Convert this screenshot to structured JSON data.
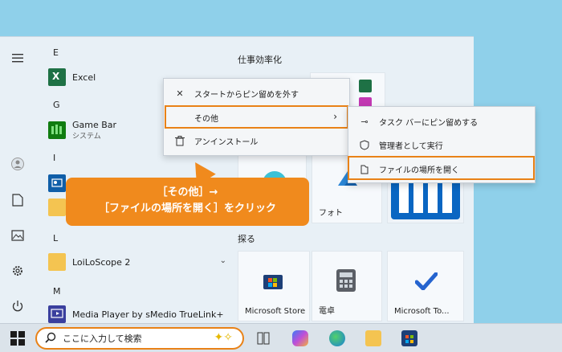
{
  "sections": {
    "letters": [
      "E",
      "G",
      "I",
      "L",
      "M"
    ],
    "pinned": "仕事効率化",
    "explore": "探る"
  },
  "apps": {
    "excel": "Excel",
    "gamebar": "Game Bar",
    "gamebar_sub": "システム",
    "loiloscope": "LoiLoScope 2",
    "mediaplayer": "Media Player by sMedio TrueLink+"
  },
  "tiles": {
    "photo": "フォト",
    "store": "Microsoft Store",
    "calc": "電卓",
    "todo": "Microsoft To..."
  },
  "context_menu": {
    "unpin": "スタートからピン留めを外す",
    "more": "その他",
    "uninstall": "アンインストール"
  },
  "submenu": {
    "pin_taskbar": "タスク バーにピン留めする",
    "run_admin": "管理者として実行",
    "open_location": "ファイルの場所を開く"
  },
  "callout": {
    "line1": "［その他］→",
    "line2": "［ファイルの場所を開く］をクリック"
  },
  "taskbar": {
    "search_placeholder": "ここに入力して検索"
  },
  "colors": {
    "accent": "#f08a1d",
    "highlight": "#e98217"
  }
}
